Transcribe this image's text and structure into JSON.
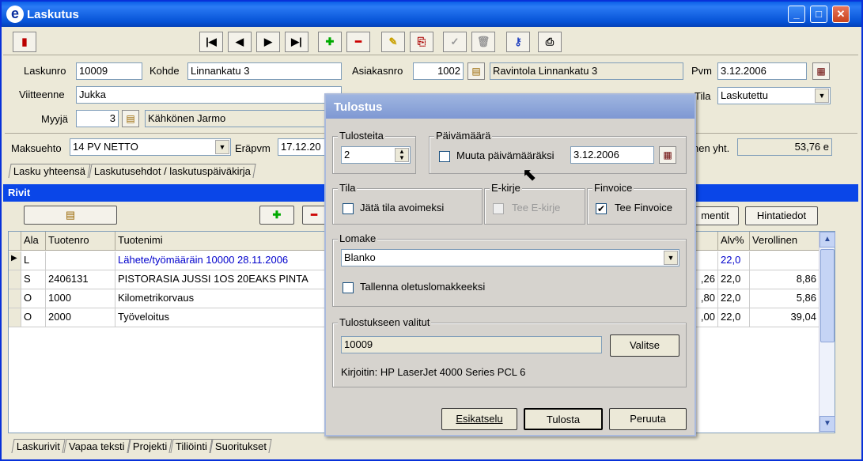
{
  "window": {
    "title": "Laskutus",
    "app_icon": "e"
  },
  "toolbar": {
    "buttons": [
      "exit-icon",
      "first-icon",
      "prev-icon",
      "next-icon",
      "last-icon",
      "add-icon",
      "delete-icon",
      "edit-icon",
      "copy-icon",
      "check-icon",
      "trash-icon",
      "key-icon",
      "print-icon"
    ]
  },
  "header": {
    "laskunro_label": "Laskunro",
    "laskunro": "10009",
    "kohde_label": "Kohde",
    "kohde": "Linnankatu 3",
    "asiakasnro_label": "Asiakasnro",
    "asiakasnro": "1002",
    "asiakas_name": "Ravintola Linnankatu 3",
    "pvm_label": "Pvm",
    "pvm": "3.12.2006",
    "viitteenne_label": "Viitteenne",
    "viitteenne": "Jukka",
    "tila_label": "Tila",
    "tila": "Laskutettu",
    "myyja_label": "Myyjä",
    "myyja_nro": "3",
    "myyja_name": "Kähkönen Jarmo",
    "maksuehto_label": "Maksuehto",
    "maksuehto": "14 PV NETTO",
    "erapvm_label": "Eräpvm",
    "erapvm": "17.12.20",
    "yht_label": "nen yht.",
    "yht_value": "53,76 e"
  },
  "tabs_top": [
    "Lasku yhteensä",
    "Laskutusehdot / laskutuspäiväkirja"
  ],
  "rivit_label": "Rivit",
  "row_buttons": {
    "mentit": "mentit",
    "hintatiedot": "Hintatiedot"
  },
  "grid": {
    "columns": [
      "Ala",
      "Tuotenro",
      "Tuotenimi",
      "Alv%",
      "Verollinen"
    ],
    "rows": [
      {
        "ala": "L",
        "tuotenro": "",
        "tuotenimi": "Lähete/työmääräin 10000 28.11.2006",
        "mid": "",
        "alv": "22,0",
        "verollinen": ""
      },
      {
        "ala": "S",
        "tuotenro": "2406131",
        "tuotenimi": "PISTORASIA JUSSI 1OS 20EAKS PINTA",
        "mid": ",26",
        "alv": "22,0",
        "verollinen": "8,86"
      },
      {
        "ala": "O",
        "tuotenro": "1000",
        "tuotenimi": "Kilometrikorvaus",
        "mid": ",80",
        "alv": "22,0",
        "verollinen": "5,86"
      },
      {
        "ala": "O",
        "tuotenro": "2000",
        "tuotenimi": "Työveloitus",
        "mid": ",00",
        "alv": "22,0",
        "verollinen": "39,04"
      }
    ]
  },
  "tabs_bottom": [
    "Laskurivit",
    "Vapaa teksti",
    "Projekti",
    "Tiliöinti",
    "Suoritukset"
  ],
  "dialog": {
    "title": "Tulostus",
    "tulosteita_label": "Tulosteita",
    "tulosteita": "2",
    "paivamaara_label": "Päivämäärä",
    "muuta_label": "Muuta päivämääräksi",
    "muuta_date": "3.12.2006",
    "tila_label": "Tila",
    "jata_label": "Jätä tila avoimeksi",
    "ekirje_label": "E-kirje",
    "tee_ekirje": "Tee E-kirje",
    "finvoice_label": "Finvoice",
    "tee_finvoice": "Tee Finvoice",
    "lomake_label": "Lomake",
    "lomake": "Blanko",
    "tallenna_label": "Tallenna oletuslomakkeeksi",
    "valitut_label": "Tulostukseen valitut",
    "valitut": "10009",
    "valitse": "Valitse",
    "kirjoitin": "Kirjoitin: HP LaserJet 4000 Series PCL 6",
    "esikatselu": "Esikatselu",
    "tulosta": "Tulosta",
    "peruuta": "Peruuta"
  }
}
